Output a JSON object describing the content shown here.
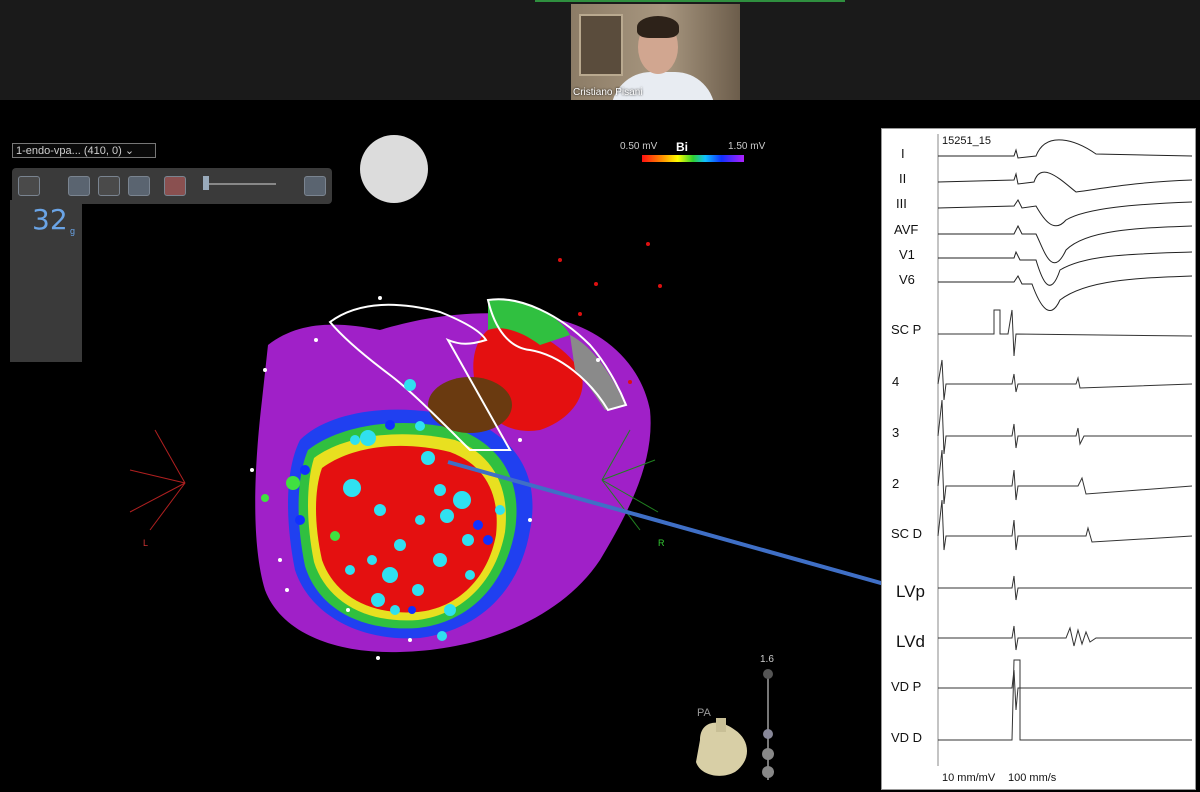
{
  "video": {
    "participant_name": "Cristiano Pisani"
  },
  "map_toolbar": {
    "map_select_value": "1-endo-vpa... (410, 0)",
    "count_value": "32",
    "count_unit": "g"
  },
  "color_scale": {
    "low_label": "0.50 mV",
    "title": "Bi",
    "high_label": "1.50 mV",
    "colors": [
      "#ff1010",
      "#ff9000",
      "#ffff00",
      "#30d030",
      "#10c0ff",
      "#1030ff",
      "#b020ff"
    ]
  },
  "orientation": {
    "left_label": "L",
    "right_label": "R",
    "view_label": "PA",
    "zoom_value": "1.6"
  },
  "ecg_panel": {
    "recording_id": "15251_15",
    "leads": [
      "I",
      "II",
      "III",
      "AVF",
      "V1",
      "V6",
      "SC P",
      "4",
      "3",
      "2",
      "SC D",
      "LVp",
      "LVd",
      "VD P",
      "VD D"
    ],
    "gain_label": "10 mm/mV",
    "speed_label": "100 mm/s"
  },
  "icons": {
    "toolbar": [
      "view-icon",
      "heart-map-icon",
      "catheter-icon",
      "pen-icon",
      "grid-icon",
      "slider-icon",
      "table-icon",
      "screen-icon"
    ],
    "orientation": [
      "heart-orientation-icon",
      "zoom-in-icon",
      "zoom-out-icon"
    ]
  }
}
